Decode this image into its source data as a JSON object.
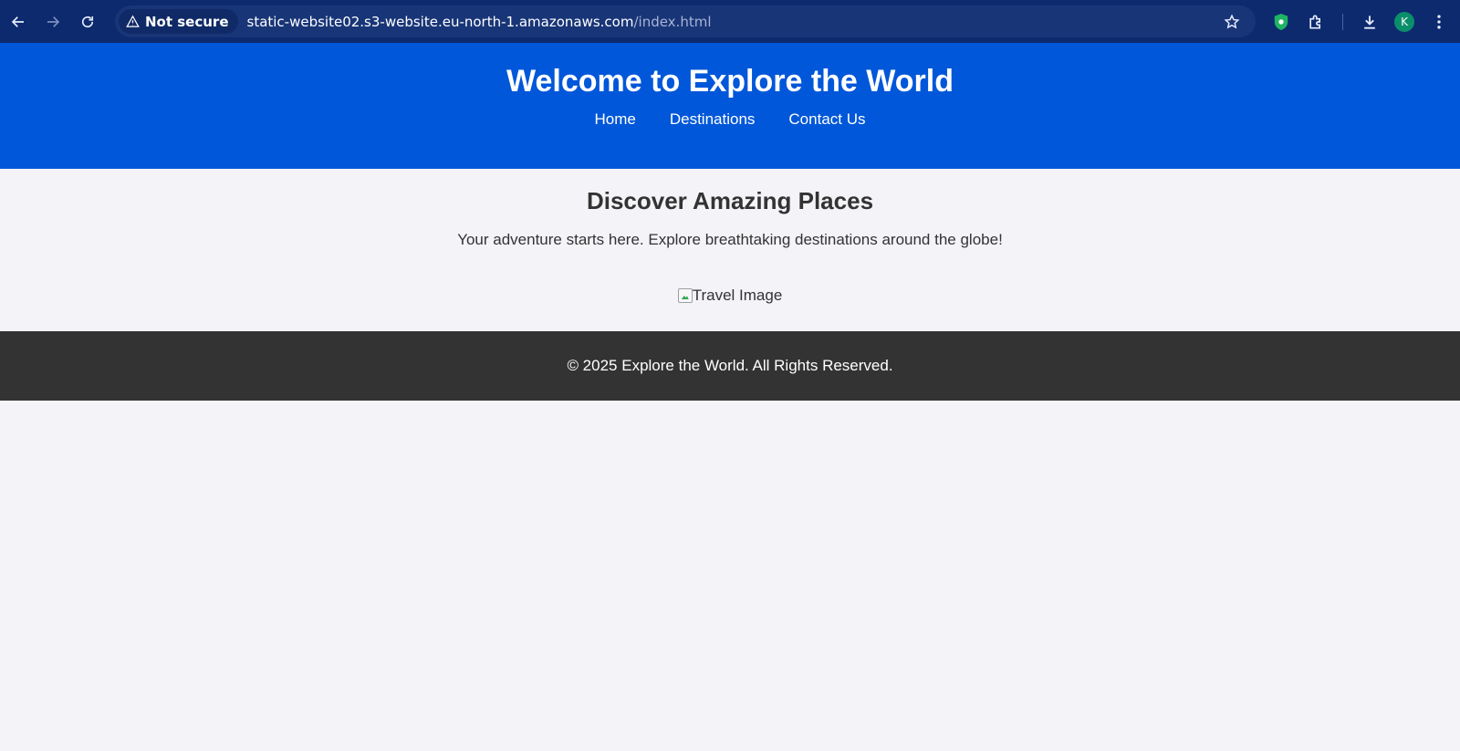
{
  "browser": {
    "security_label": "Not secure",
    "url_host": "static-website02.s3-website.eu-north-1.amazonaws.com",
    "url_path": "/index.html",
    "profile_initial": "K",
    "icons": [
      "back-arrow-icon",
      "forward-arrow-icon",
      "reload-icon",
      "warning-icon",
      "star-icon",
      "shield-extension-icon",
      "puzzle-icon",
      "download-icon",
      "kebab-menu-icon"
    ]
  },
  "header": {
    "title": "Welcome to Explore the World",
    "nav": [
      "Home",
      "Destinations",
      "Contact Us"
    ]
  },
  "main": {
    "heading": "Discover Amazing Places",
    "tagline": "Your adventure starts here. Explore breathtaking destinations around the globe!",
    "image_alt": "Travel Image"
  },
  "footer": {
    "text": "© 2025 Explore the World. All Rights Reserved."
  },
  "colors": {
    "header_bg": "#0057d9",
    "footer_bg": "#333333",
    "page_bg": "#f4f3f8",
    "browser_bg": "#0d2a6e"
  }
}
